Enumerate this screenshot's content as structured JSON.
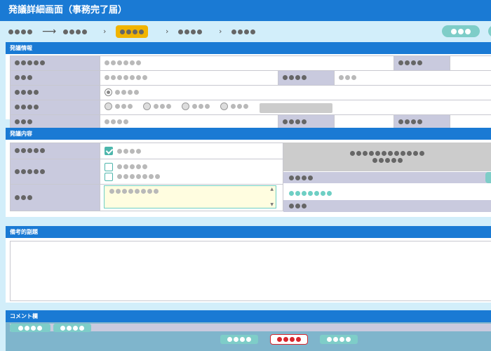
{
  "window": {
    "title": "発議詳細画面（事務完了届）"
  },
  "steps": {
    "arrow": "⟶",
    "chevron": "›"
  },
  "sections": {
    "info": "発議情報",
    "content": "発議内容",
    "remarks": "備考的副題",
    "comment": "コメント欄"
  },
  "textarea": {
    "up": "▲",
    "down": "▼"
  },
  "colors": {
    "header": "#1a7ad4",
    "background": "#d2eefa",
    "label_cell": "#c9cade",
    "current_step": "#f1b400",
    "teal": "#7ecdc8",
    "danger": "#d9262c"
  },
  "icons": [
    "checkbox-checked-icon",
    "checkbox-icon",
    "radio-icon",
    "radio-selected-icon",
    "arrow-right-icon",
    "chevron-right-icon",
    "scroll-up-icon",
    "scroll-down-icon"
  ]
}
